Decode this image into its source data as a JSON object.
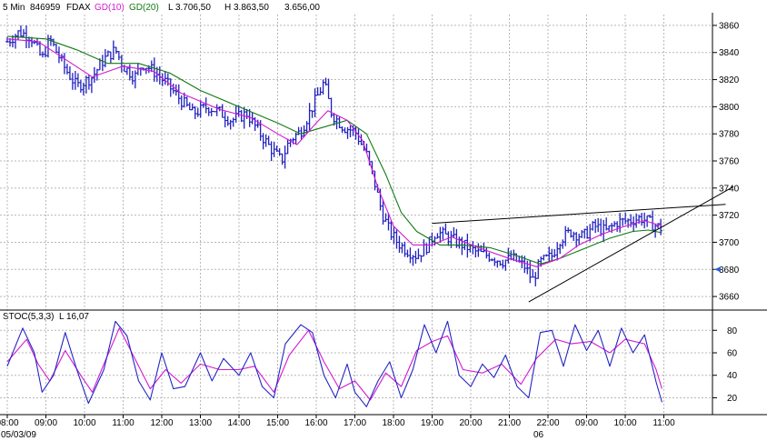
{
  "header": {
    "interval": "5 Min",
    "id": "846959",
    "symbol": "FDAX",
    "ma1_label": "GD(10)",
    "ma2_label": "GD(20)",
    "low_label": "L 3.706,50",
    "high_label": "H 3.863,50",
    "last_label": "3.656,00"
  },
  "stoch": {
    "label": "STOC(5,3,3)",
    "last_label": "L 16,07"
  },
  "colors": {
    "bars": "#1f1fbf",
    "ma10": "#d21ad2",
    "ma20": "#127a12",
    "stoch_k": "#2525c4",
    "stoch_d": "#d21ad2",
    "trendline": "#000000",
    "marker": "#2d5fd6"
  },
  "date_labels": {
    "left": "05/03/09",
    "right": "06"
  },
  "chart_data": [
    {
      "type": "line",
      "title": "",
      "series_names": [
        "FDAX",
        "GD(10)",
        "GD(20)"
      ],
      "x_ticks": [
        "08:00",
        "09:00",
        "10:00",
        "11:00",
        "12:00",
        "13:00",
        "14:00",
        "15:00",
        "16:00",
        "17:00",
        "18:00",
        "19:00",
        "20:00",
        "21:00",
        "22:00",
        "09:00",
        "10:00",
        "11:00"
      ],
      "y_ticks": [
        3660,
        3680,
        3700,
        3720,
        3740,
        3760,
        3780,
        3800,
        3820,
        3840,
        3860
      ],
      "ylim": [
        3650,
        3868
      ],
      "grid": true,
      "close_path": [
        {
          "x": 0,
          "y": 3848
        },
        {
          "x": 0.3,
          "y": 3855
        },
        {
          "x": 0.6,
          "y": 3852
        },
        {
          "x": 0.9,
          "y": 3835
        },
        {
          "x": 1.1,
          "y": 3850
        },
        {
          "x": 1.5,
          "y": 3828
        },
        {
          "x": 1.8,
          "y": 3815
        },
        {
          "x": 2.2,
          "y": 3822
        },
        {
          "x": 2.5,
          "y": 3835
        },
        {
          "x": 2.8,
          "y": 3842
        },
        {
          "x": 3.0,
          "y": 3830
        },
        {
          "x": 3.3,
          "y": 3822
        },
        {
          "x": 3.5,
          "y": 3832
        },
        {
          "x": 3.8,
          "y": 3826
        },
        {
          "x": 4.1,
          "y": 3818
        },
        {
          "x": 4.4,
          "y": 3808
        },
        {
          "x": 4.8,
          "y": 3795
        },
        {
          "x": 5.2,
          "y": 3800
        },
        {
          "x": 5.5,
          "y": 3796
        },
        {
          "x": 5.8,
          "y": 3790
        },
        {
          "x": 6.2,
          "y": 3795
        },
        {
          "x": 6.5,
          "y": 3782
        },
        {
          "x": 6.8,
          "y": 3770
        },
        {
          "x": 7.1,
          "y": 3760
        },
        {
          "x": 7.3,
          "y": 3775
        },
        {
          "x": 7.6,
          "y": 3782
        },
        {
          "x": 7.9,
          "y": 3800
        },
        {
          "x": 8.2,
          "y": 3818
        },
        {
          "x": 8.4,
          "y": 3795
        },
        {
          "x": 8.7,
          "y": 3785
        },
        {
          "x": 9.0,
          "y": 3782
        },
        {
          "x": 9.3,
          "y": 3765
        },
        {
          "x": 9.5,
          "y": 3745
        },
        {
          "x": 9.7,
          "y": 3722
        },
        {
          "x": 9.9,
          "y": 3708
        },
        {
          "x": 10.1,
          "y": 3700
        },
        {
          "x": 10.3,
          "y": 3695
        },
        {
          "x": 10.6,
          "y": 3690
        },
        {
          "x": 10.9,
          "y": 3698
        },
        {
          "x": 11.1,
          "y": 3708
        },
        {
          "x": 11.4,
          "y": 3704
        },
        {
          "x": 11.8,
          "y": 3698
        },
        {
          "x": 12.2,
          "y": 3692
        },
        {
          "x": 12.5,
          "y": 3690
        },
        {
          "x": 12.8,
          "y": 3686
        },
        {
          "x": 13.1,
          "y": 3688
        },
        {
          "x": 13.4,
          "y": 3682
        },
        {
          "x": 13.6,
          "y": 3672
        },
        {
          "x": 13.8,
          "y": 3685
        },
        {
          "x": 14.1,
          "y": 3690
        },
        {
          "x": 14.3,
          "y": 3702
        },
        {
          "x": 14.6,
          "y": 3708
        },
        {
          "x": 14.9,
          "y": 3704
        },
        {
          "x": 15.2,
          "y": 3712
        },
        {
          "x": 15.5,
          "y": 3708
        },
        {
          "x": 15.8,
          "y": 3715
        },
        {
          "x": 16.1,
          "y": 3716
        },
        {
          "x": 16.4,
          "y": 3718
        },
        {
          "x": 16.6,
          "y": 3715
        },
        {
          "x": 16.8,
          "y": 3712
        },
        {
          "x": 16.95,
          "y": 3710
        }
      ],
      "ma10_path": [
        {
          "x": 0,
          "y": 3850
        },
        {
          "x": 0.8,
          "y": 3848
        },
        {
          "x": 1.5,
          "y": 3835
        },
        {
          "x": 2.2,
          "y": 3822
        },
        {
          "x": 3.0,
          "y": 3830
        },
        {
          "x": 3.8,
          "y": 3826
        },
        {
          "x": 4.5,
          "y": 3810
        },
        {
          "x": 5.5,
          "y": 3798
        },
        {
          "x": 6.3,
          "y": 3792
        },
        {
          "x": 7.0,
          "y": 3780
        },
        {
          "x": 7.5,
          "y": 3772
        },
        {
          "x": 8.0,
          "y": 3788
        },
        {
          "x": 8.3,
          "y": 3797
        },
        {
          "x": 8.8,
          "y": 3790
        },
        {
          "x": 9.2,
          "y": 3775
        },
        {
          "x": 9.6,
          "y": 3740
        },
        {
          "x": 10.0,
          "y": 3712
        },
        {
          "x": 10.5,
          "y": 3698
        },
        {
          "x": 11.0,
          "y": 3698
        },
        {
          "x": 11.5,
          "y": 3704
        },
        {
          "x": 12.2,
          "y": 3696
        },
        {
          "x": 13.0,
          "y": 3688
        },
        {
          "x": 13.7,
          "y": 3682
        },
        {
          "x": 14.3,
          "y": 3688
        },
        {
          "x": 14.8,
          "y": 3698
        },
        {
          "x": 15.4,
          "y": 3706
        },
        {
          "x": 16.0,
          "y": 3712
        },
        {
          "x": 16.5,
          "y": 3716
        },
        {
          "x": 16.95,
          "y": 3712
        }
      ],
      "ma20_path": [
        {
          "x": 0,
          "y": 3852
        },
        {
          "x": 1.0,
          "y": 3850
        },
        {
          "x": 1.8,
          "y": 3842
        },
        {
          "x": 2.6,
          "y": 3832
        },
        {
          "x": 3.4,
          "y": 3832
        },
        {
          "x": 4.2,
          "y": 3825
        },
        {
          "x": 5.0,
          "y": 3812
        },
        {
          "x": 6.0,
          "y": 3800
        },
        {
          "x": 7.0,
          "y": 3788
        },
        {
          "x": 7.6,
          "y": 3780
        },
        {
          "x": 8.2,
          "y": 3785
        },
        {
          "x": 8.8,
          "y": 3790
        },
        {
          "x": 9.3,
          "y": 3780
        },
        {
          "x": 9.8,
          "y": 3750
        },
        {
          "x": 10.2,
          "y": 3722
        },
        {
          "x": 10.6,
          "y": 3708
        },
        {
          "x": 11.2,
          "y": 3698
        },
        {
          "x": 11.8,
          "y": 3698
        },
        {
          "x": 12.5,
          "y": 3696
        },
        {
          "x": 13.2,
          "y": 3690
        },
        {
          "x": 13.8,
          "y": 3684
        },
        {
          "x": 14.3,
          "y": 3688
        },
        {
          "x": 15.0,
          "y": 3696
        },
        {
          "x": 15.6,
          "y": 3703
        },
        {
          "x": 16.2,
          "y": 3708
        },
        {
          "x": 16.6,
          "y": 3709
        },
        {
          "x": 16.95,
          "y": 3707
        }
      ],
      "trendlines": [
        {
          "x1": 11.0,
          "y1": 3714,
          "x2": 18.6,
          "y2": 3728
        },
        {
          "x1": 13.5,
          "y1": 3656,
          "x2": 18.8,
          "y2": 3741
        }
      ],
      "last_price": 3680
    },
    {
      "type": "line",
      "title": "",
      "series_names": [
        "STOC(5,3,3)"
      ],
      "x_ticks": [
        "08:00",
        "09:00",
        "10:00",
        "11:00",
        "12:00",
        "13:00",
        "14:00",
        "15:00",
        "16:00",
        "17:00",
        "18:00",
        "19:00",
        "20:00",
        "21:00",
        "22:00",
        "09:00",
        "10:00",
        "11:00"
      ],
      "y_ticks": [
        20,
        40,
        60,
        80
      ],
      "ylim": [
        5,
        98
      ],
      "grid": true,
      "k_path": [
        {
          "x": 0,
          "y": 48
        },
        {
          "x": 0.4,
          "y": 82
        },
        {
          "x": 0.7,
          "y": 60
        },
        {
          "x": 0.9,
          "y": 25
        },
        {
          "x": 1.2,
          "y": 40
        },
        {
          "x": 1.5,
          "y": 78
        },
        {
          "x": 1.8,
          "y": 45
        },
        {
          "x": 2.1,
          "y": 15
        },
        {
          "x": 2.5,
          "y": 45
        },
        {
          "x": 2.8,
          "y": 88
        },
        {
          "x": 3.1,
          "y": 75
        },
        {
          "x": 3.4,
          "y": 35
        },
        {
          "x": 3.7,
          "y": 18
        },
        {
          "x": 4.0,
          "y": 60
        },
        {
          "x": 4.3,
          "y": 28
        },
        {
          "x": 4.6,
          "y": 30
        },
        {
          "x": 5.0,
          "y": 60
        },
        {
          "x": 5.3,
          "y": 35
        },
        {
          "x": 5.6,
          "y": 55
        },
        {
          "x": 6.0,
          "y": 40
        },
        {
          "x": 6.3,
          "y": 60
        },
        {
          "x": 6.6,
          "y": 30
        },
        {
          "x": 6.9,
          "y": 20
        },
        {
          "x": 7.2,
          "y": 68
        },
        {
          "x": 7.6,
          "y": 85
        },
        {
          "x": 7.9,
          "y": 78
        },
        {
          "x": 8.2,
          "y": 40
        },
        {
          "x": 8.5,
          "y": 20
        },
        {
          "x": 8.8,
          "y": 50
        },
        {
          "x": 9.0,
          "y": 25
        },
        {
          "x": 9.3,
          "y": 12
        },
        {
          "x": 9.6,
          "y": 35
        },
        {
          "x": 9.9,
          "y": 52
        },
        {
          "x": 10.2,
          "y": 20
        },
        {
          "x": 10.5,
          "y": 45
        },
        {
          "x": 10.8,
          "y": 85
        },
        {
          "x": 11.1,
          "y": 60
        },
        {
          "x": 11.4,
          "y": 88
        },
        {
          "x": 11.7,
          "y": 40
        },
        {
          "x": 12.0,
          "y": 30
        },
        {
          "x": 12.3,
          "y": 50
        },
        {
          "x": 12.6,
          "y": 38
        },
        {
          "x": 12.9,
          "y": 58
        },
        {
          "x": 13.2,
          "y": 30
        },
        {
          "x": 13.5,
          "y": 20
        },
        {
          "x": 13.8,
          "y": 78
        },
        {
          "x": 14.1,
          "y": 80
        },
        {
          "x": 14.4,
          "y": 48
        },
        {
          "x": 14.7,
          "y": 85
        },
        {
          "x": 15.0,
          "y": 62
        },
        {
          "x": 15.3,
          "y": 80
        },
        {
          "x": 15.6,
          "y": 48
        },
        {
          "x": 15.9,
          "y": 82
        },
        {
          "x": 16.2,
          "y": 60
        },
        {
          "x": 16.5,
          "y": 76
        },
        {
          "x": 16.8,
          "y": 34
        },
        {
          "x": 16.95,
          "y": 16
        }
      ],
      "d_path": [
        {
          "x": 0,
          "y": 52
        },
        {
          "x": 0.5,
          "y": 72
        },
        {
          "x": 0.8,
          "y": 50
        },
        {
          "x": 1.1,
          "y": 35
        },
        {
          "x": 1.5,
          "y": 62
        },
        {
          "x": 1.9,
          "y": 40
        },
        {
          "x": 2.2,
          "y": 25
        },
        {
          "x": 2.6,
          "y": 58
        },
        {
          "x": 2.9,
          "y": 82
        },
        {
          "x": 3.3,
          "y": 55
        },
        {
          "x": 3.7,
          "y": 28
        },
        {
          "x": 4.1,
          "y": 45
        },
        {
          "x": 4.5,
          "y": 33
        },
        {
          "x": 5.0,
          "y": 50
        },
        {
          "x": 5.5,
          "y": 45
        },
        {
          "x": 6.0,
          "y": 45
        },
        {
          "x": 6.4,
          "y": 48
        },
        {
          "x": 6.9,
          "y": 25
        },
        {
          "x": 7.3,
          "y": 58
        },
        {
          "x": 7.8,
          "y": 80
        },
        {
          "x": 8.2,
          "y": 52
        },
        {
          "x": 8.6,
          "y": 28
        },
        {
          "x": 9.0,
          "y": 35
        },
        {
          "x": 9.4,
          "y": 18
        },
        {
          "x": 9.8,
          "y": 42
        },
        {
          "x": 10.2,
          "y": 30
        },
        {
          "x": 10.6,
          "y": 62
        },
        {
          "x": 11.0,
          "y": 70
        },
        {
          "x": 11.4,
          "y": 75
        },
        {
          "x": 11.8,
          "y": 45
        },
        {
          "x": 12.3,
          "y": 42
        },
        {
          "x": 12.8,
          "y": 50
        },
        {
          "x": 13.3,
          "y": 32
        },
        {
          "x": 13.7,
          "y": 55
        },
        {
          "x": 14.2,
          "y": 72
        },
        {
          "x": 14.6,
          "y": 68
        },
        {
          "x": 15.1,
          "y": 70
        },
        {
          "x": 15.6,
          "y": 60
        },
        {
          "x": 16.0,
          "y": 72
        },
        {
          "x": 16.5,
          "y": 68
        },
        {
          "x": 16.8,
          "y": 45
        },
        {
          "x": 16.95,
          "y": 28
        }
      ]
    }
  ]
}
